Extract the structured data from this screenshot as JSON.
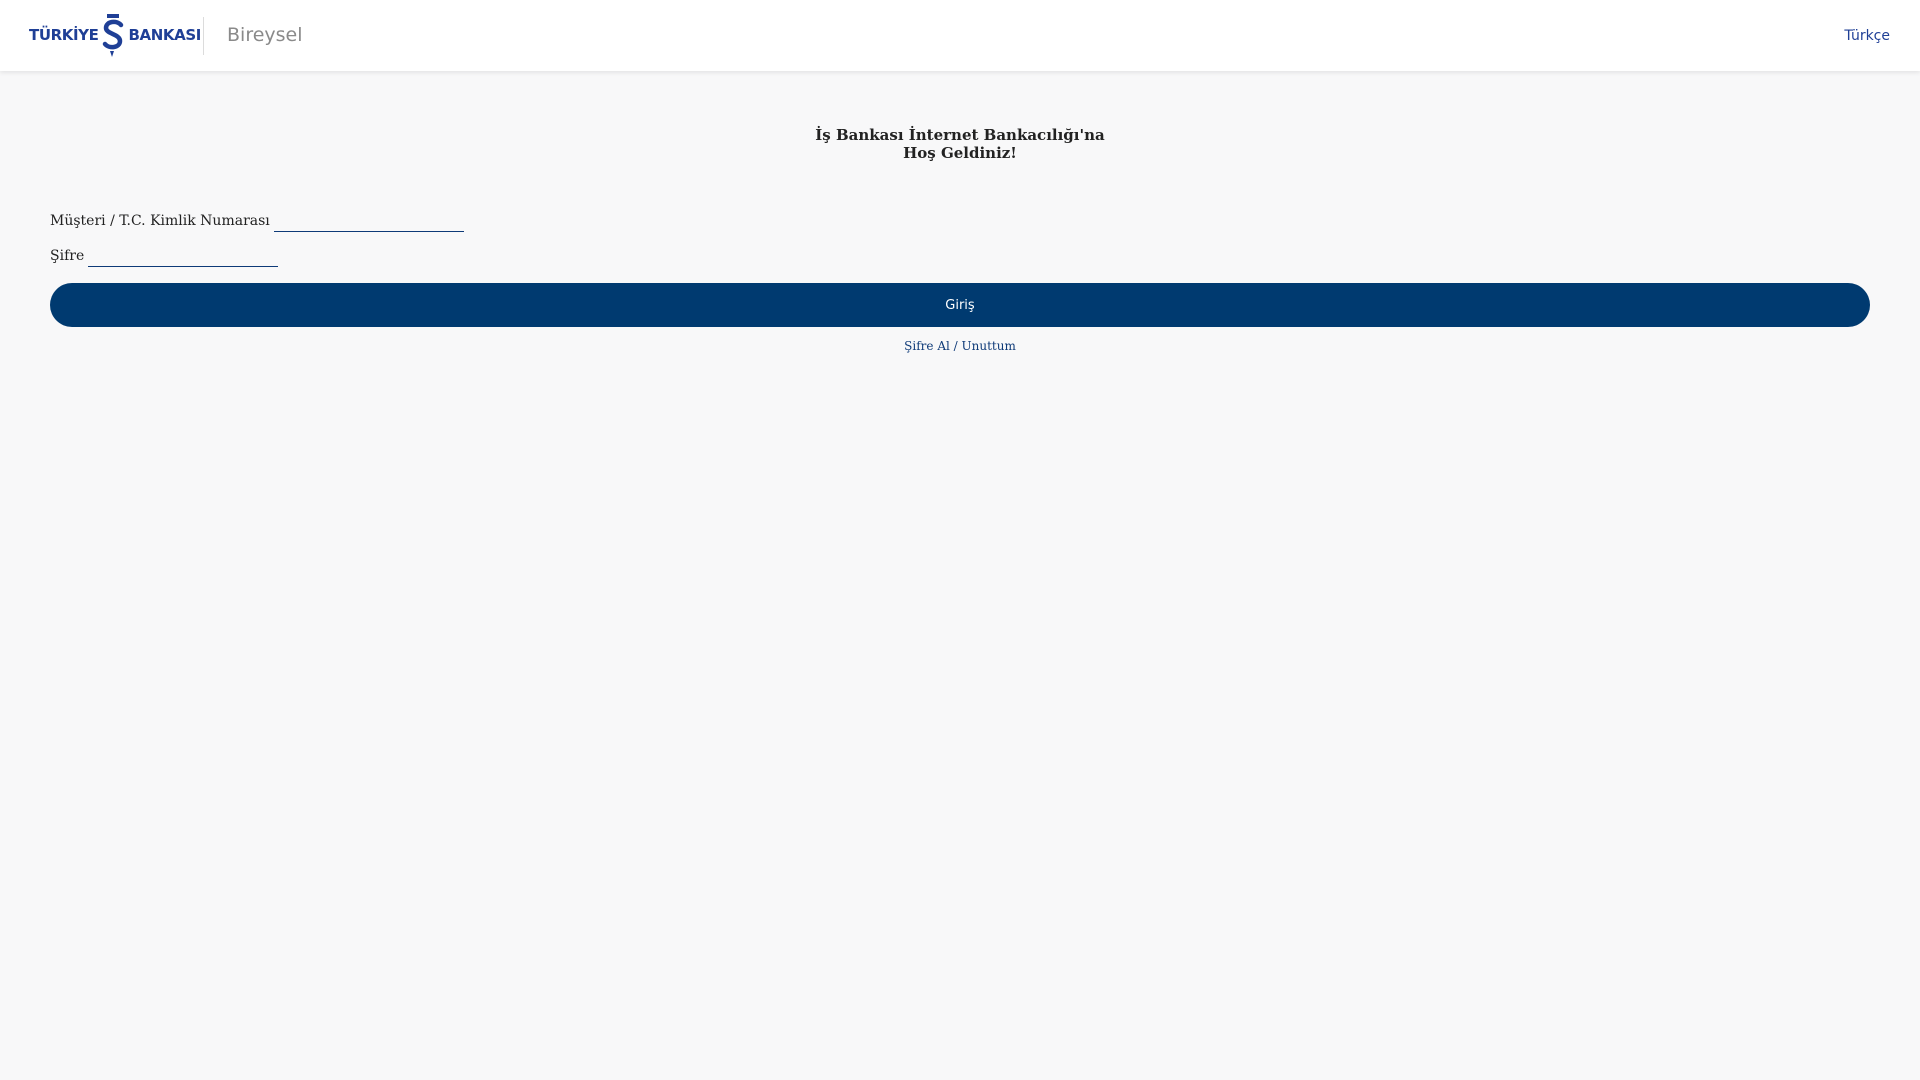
{
  "header": {
    "logo": {
      "left_text": "TÜRKİYE",
      "right_text": "BANKASI",
      "mark_icon": "is-bankasi-logo-icon"
    },
    "section_name": "Bireysel",
    "language": "Türkçe"
  },
  "login": {
    "welcome_line1": "İş Bankası İnternet Bankacılığı'na",
    "welcome_line2": "Hoş Geldiniz!",
    "customer_label": "Müşteri / T.C. Kimlik Numarası",
    "customer_value": "",
    "password_label": "Şifre",
    "password_value": "",
    "submit_label": "Giriş",
    "forgot_label": "Şifre Al / Unuttum"
  },
  "colors": {
    "brand_blue": "#1f3f96",
    "button_blue": "#003a70",
    "background": "#f8f8f9"
  }
}
